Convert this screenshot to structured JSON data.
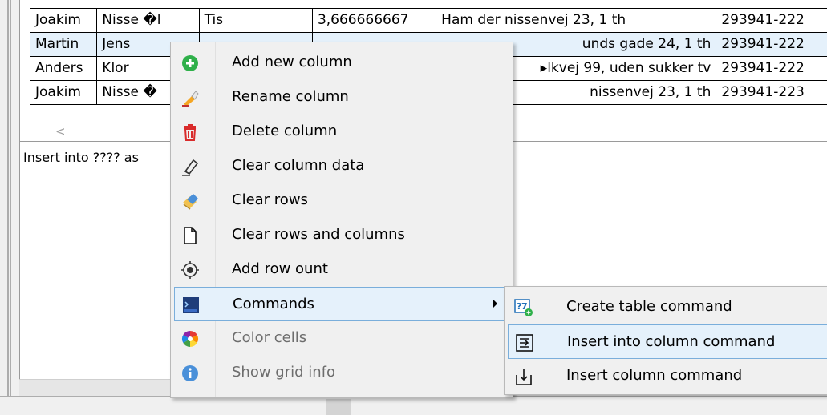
{
  "grid": {
    "rows": [
      [
        "Joakim",
        "Nisse �l",
        "Tis",
        "3,666666667",
        "Ham der nissenvej 23, 1 th",
        "293941-222"
      ],
      [
        "Martin",
        "Jens",
        "",
        "",
        "unds gade 24, 1 th",
        "293941-222"
      ],
      [
        "Anders",
        "Klor",
        "",
        "",
        "▸lkvej 99, uden sukker tv",
        "293941-222"
      ],
      [
        "Joakim",
        "Nisse �",
        "",
        "",
        "nissenvej 23, 1 th",
        "293941-223"
      ]
    ],
    "scroll_left": "<"
  },
  "text_panel": {
    "line": "Insert into ???? as"
  },
  "context_menu": {
    "items": [
      {
        "label": "Add new column",
        "icon": "add-icon"
      },
      {
        "label": "Rename column",
        "icon": "rename-icon"
      },
      {
        "label": "Delete column",
        "icon": "trash-icon"
      },
      {
        "label": "Clear column data",
        "icon": "eraser-icon"
      },
      {
        "label": "Clear rows",
        "icon": "broom-icon"
      },
      {
        "label": "Clear rows and columns",
        "icon": "blank-page-icon"
      },
      {
        "label": "Add row ount",
        "icon": "row-count-icon"
      },
      {
        "label": "Commands",
        "icon": "sql-icon"
      },
      {
        "label": "Color cells",
        "icon": "color-wheel-icon"
      },
      {
        "label": "Show grid info",
        "icon": "info-icon"
      }
    ]
  },
  "submenu": {
    "items": [
      {
        "label": "Create table command",
        "icon": "create-table-icon"
      },
      {
        "label": "Insert into column command",
        "icon": "insert-into-icon"
      },
      {
        "label": "Insert column command",
        "icon": "insert-column-icon"
      }
    ]
  },
  "colors": {
    "selection": "#e5f1fb",
    "selection_border": "#7aaedb",
    "menu_bg": "#f0f0f0",
    "disabled_text": "#6d6d6d"
  }
}
